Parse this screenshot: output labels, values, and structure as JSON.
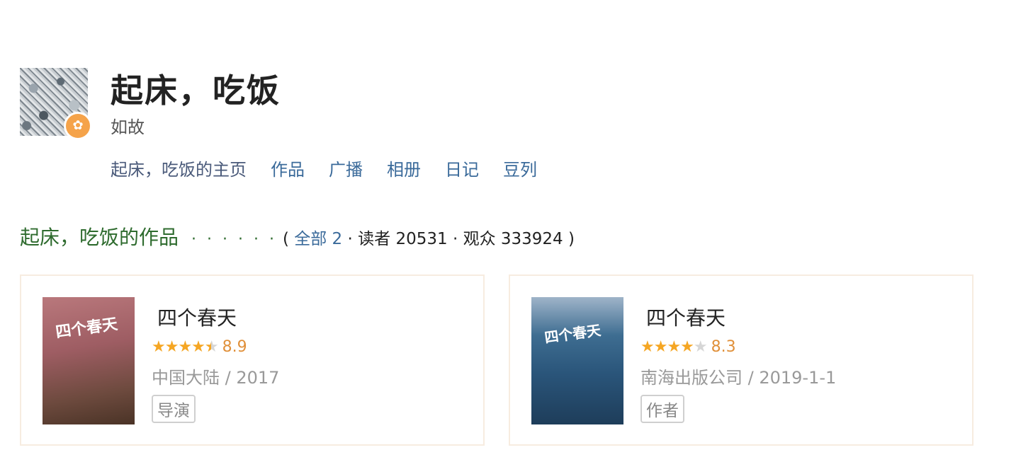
{
  "profile": {
    "name": "起床，吃饭",
    "subtitle": "如故",
    "badge_icon": "flower-icon"
  },
  "nav": {
    "items": [
      "起床，吃饭的主页",
      "作品",
      "广播",
      "相册",
      "日记",
      "豆列"
    ]
  },
  "section": {
    "title": "起床，吃饭的作品",
    "dots": "· · · · · ·",
    "open_paren": "(",
    "all_link": "全部 2",
    "sep1": "·",
    "readers": "读者 20531",
    "sep2": "·",
    "audience": "观众 333924",
    "close_paren": ")"
  },
  "works": [
    {
      "title": "四个春天",
      "stars": 4.5,
      "score": "8.9",
      "info": "中国大陆 / 2017",
      "role": "导演",
      "cover_text": "四个春天"
    },
    {
      "title": "四个春天",
      "stars": 4,
      "score": "8.3",
      "info": "南海出版公司 / 2019-1-1",
      "role": "作者",
      "cover_text": "四个春天"
    }
  ],
  "colors": {
    "link": "#3a6a9a",
    "section_title": "#2e6b2e",
    "star": "#f5a623",
    "score": "#e0903a"
  }
}
